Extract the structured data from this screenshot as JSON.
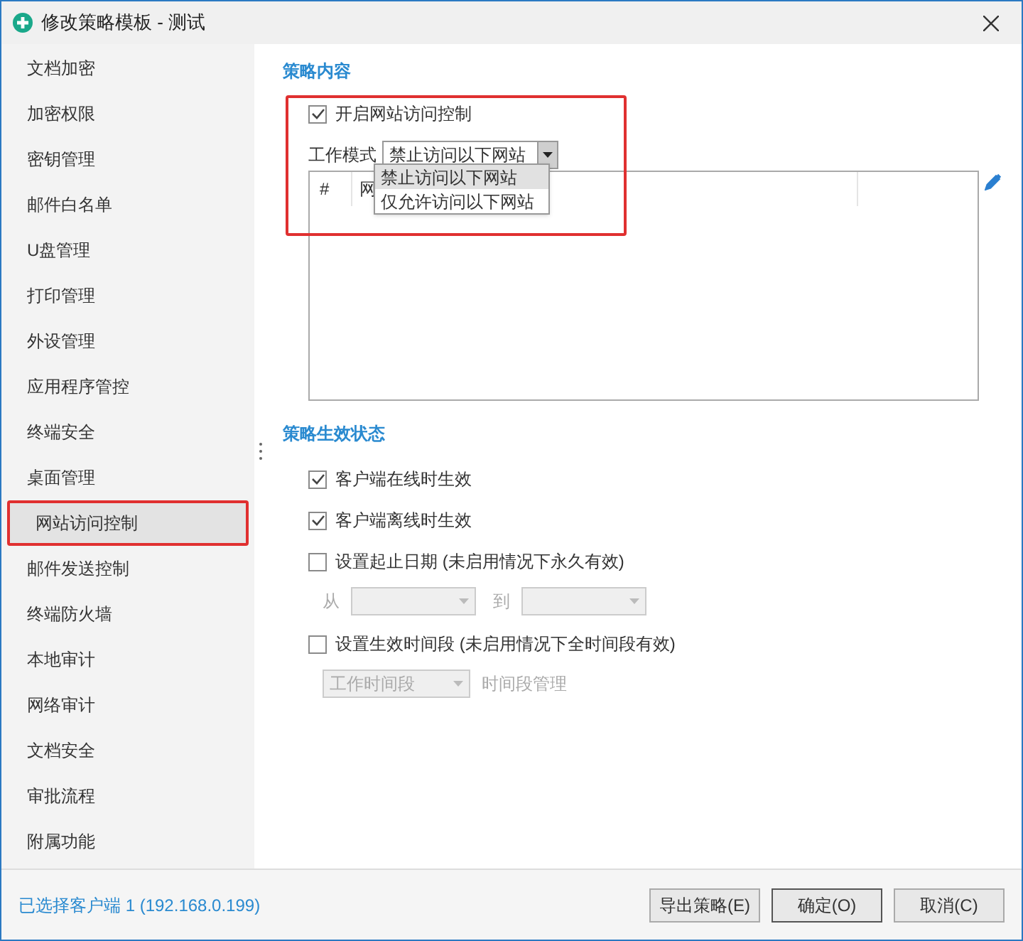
{
  "window": {
    "title": "修改策略模板 - 测试"
  },
  "sidebar": {
    "items": [
      {
        "label": "文档加密",
        "selected": false
      },
      {
        "label": "加密权限",
        "selected": false
      },
      {
        "label": "密钥管理",
        "selected": false
      },
      {
        "label": "邮件白名单",
        "selected": false
      },
      {
        "label": "U盘管理",
        "selected": false
      },
      {
        "label": "打印管理",
        "selected": false
      },
      {
        "label": "外设管理",
        "selected": false
      },
      {
        "label": "应用程序管控",
        "selected": false
      },
      {
        "label": "终端安全",
        "selected": false
      },
      {
        "label": "桌面管理",
        "selected": false
      },
      {
        "label": "网站访问控制",
        "selected": true
      },
      {
        "label": "邮件发送控制",
        "selected": false
      },
      {
        "label": "终端防火墙",
        "selected": false
      },
      {
        "label": "本地审计",
        "selected": false
      },
      {
        "label": "网络审计",
        "selected": false
      },
      {
        "label": "文档安全",
        "selected": false
      },
      {
        "label": "审批流程",
        "selected": false
      },
      {
        "label": "附属功能",
        "selected": false
      }
    ]
  },
  "policy_content": {
    "heading": "策略内容",
    "enable": {
      "label": "开启网站访问控制",
      "checked": true
    },
    "mode_label": "工作模式",
    "mode_value": "禁止访问以下网站",
    "mode_options": [
      {
        "label": "禁止访问以下网站",
        "selected": true
      },
      {
        "label": "仅允许访问以下网站",
        "selected": false
      }
    ],
    "table": {
      "columns": [
        "#",
        "网"
      ]
    }
  },
  "policy_status": {
    "heading": "策略生效状态",
    "options": [
      {
        "label": "客户端在线时生效",
        "checked": true
      },
      {
        "label": "客户端离线时生效",
        "checked": true
      },
      {
        "label": "设置起止日期 (未启用情况下永久有效)",
        "checked": false
      },
      {
        "label": "设置生效时间段 (未启用情况下全时间段有效)",
        "checked": false
      }
    ],
    "from_label": "从",
    "to_label": "到",
    "period_value": "工作时间段",
    "period_link": "时间段管理"
  },
  "status_bar": "已选择客户端 1 (192.168.0.199)",
  "buttons": [
    "导出策略(E)",
    "确定(O)",
    "取消(C)"
  ]
}
